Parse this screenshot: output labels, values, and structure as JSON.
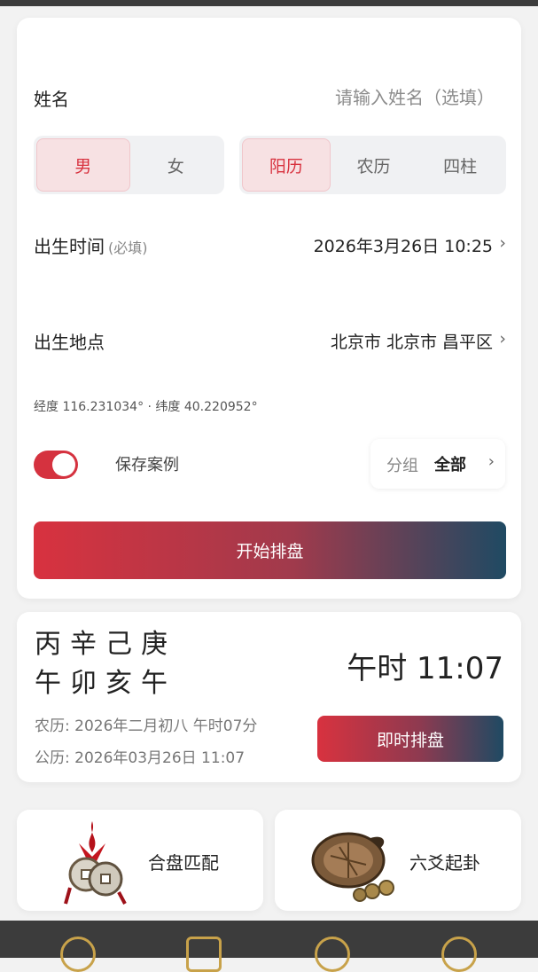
{
  "form": {
    "name_label": "姓名",
    "name_placeholder": "请输入姓名（选填）",
    "gender": [
      {
        "label": "男",
        "active": true
      },
      {
        "label": "女",
        "active": false
      }
    ],
    "calendar": [
      {
        "label": "阳历",
        "active": true
      },
      {
        "label": "农历",
        "active": false
      },
      {
        "label": "四柱",
        "active": false
      }
    ],
    "birth_time_label": "出生时间",
    "birth_time_required": "(必填)",
    "birth_time_value": "2026年3月26日 10:25",
    "birth_place_label": "出生地点",
    "birth_place_value": "北京市 北京市 昌平区",
    "coords_text": "经度 116.231034° · 纬度 40.220952°",
    "save_case_label": "保存案例",
    "save_case_on": true,
    "group_label": "分组",
    "group_value": "全部",
    "start_button": "开始排盘"
  },
  "bazi": {
    "stems": "丙辛己庚",
    "branches": "午卯亥午",
    "hour_time": "午时 11:07",
    "lunar": "农历:  2026年二月初八 午时07分",
    "solar": "公历:  2026年03月26日 11:07",
    "instant_button": "即时排盘"
  },
  "features": [
    {
      "label": "合盘匹配",
      "icon": "coins-knot-icon"
    },
    {
      "label": "六爻起卦",
      "icon": "tortoise-shell-icon"
    }
  ],
  "colors": {
    "accent": "#d8323f",
    "gradient_end": "#1f4a63",
    "nav_icon": "#c8a24a"
  },
  "chevron": "›"
}
